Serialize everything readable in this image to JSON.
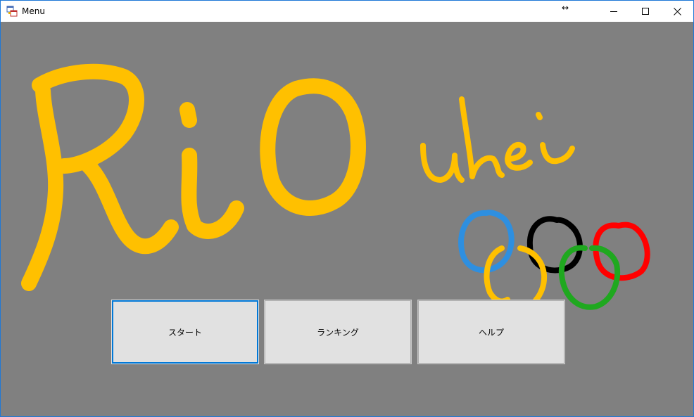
{
  "window": {
    "title": "Menu",
    "resize_glyph": "↔"
  },
  "drawing": {
    "logo_text": "RiO",
    "sub_text": "uhei",
    "ring_colors": [
      "#2e8fe0",
      "#ffc000",
      "#000000",
      "#1fa81f",
      "#ff0000"
    ],
    "text_color": "#ffc000"
  },
  "buttons": {
    "start_label": "スタート",
    "ranking_label": "ランキング",
    "help_label": "ヘルプ"
  }
}
